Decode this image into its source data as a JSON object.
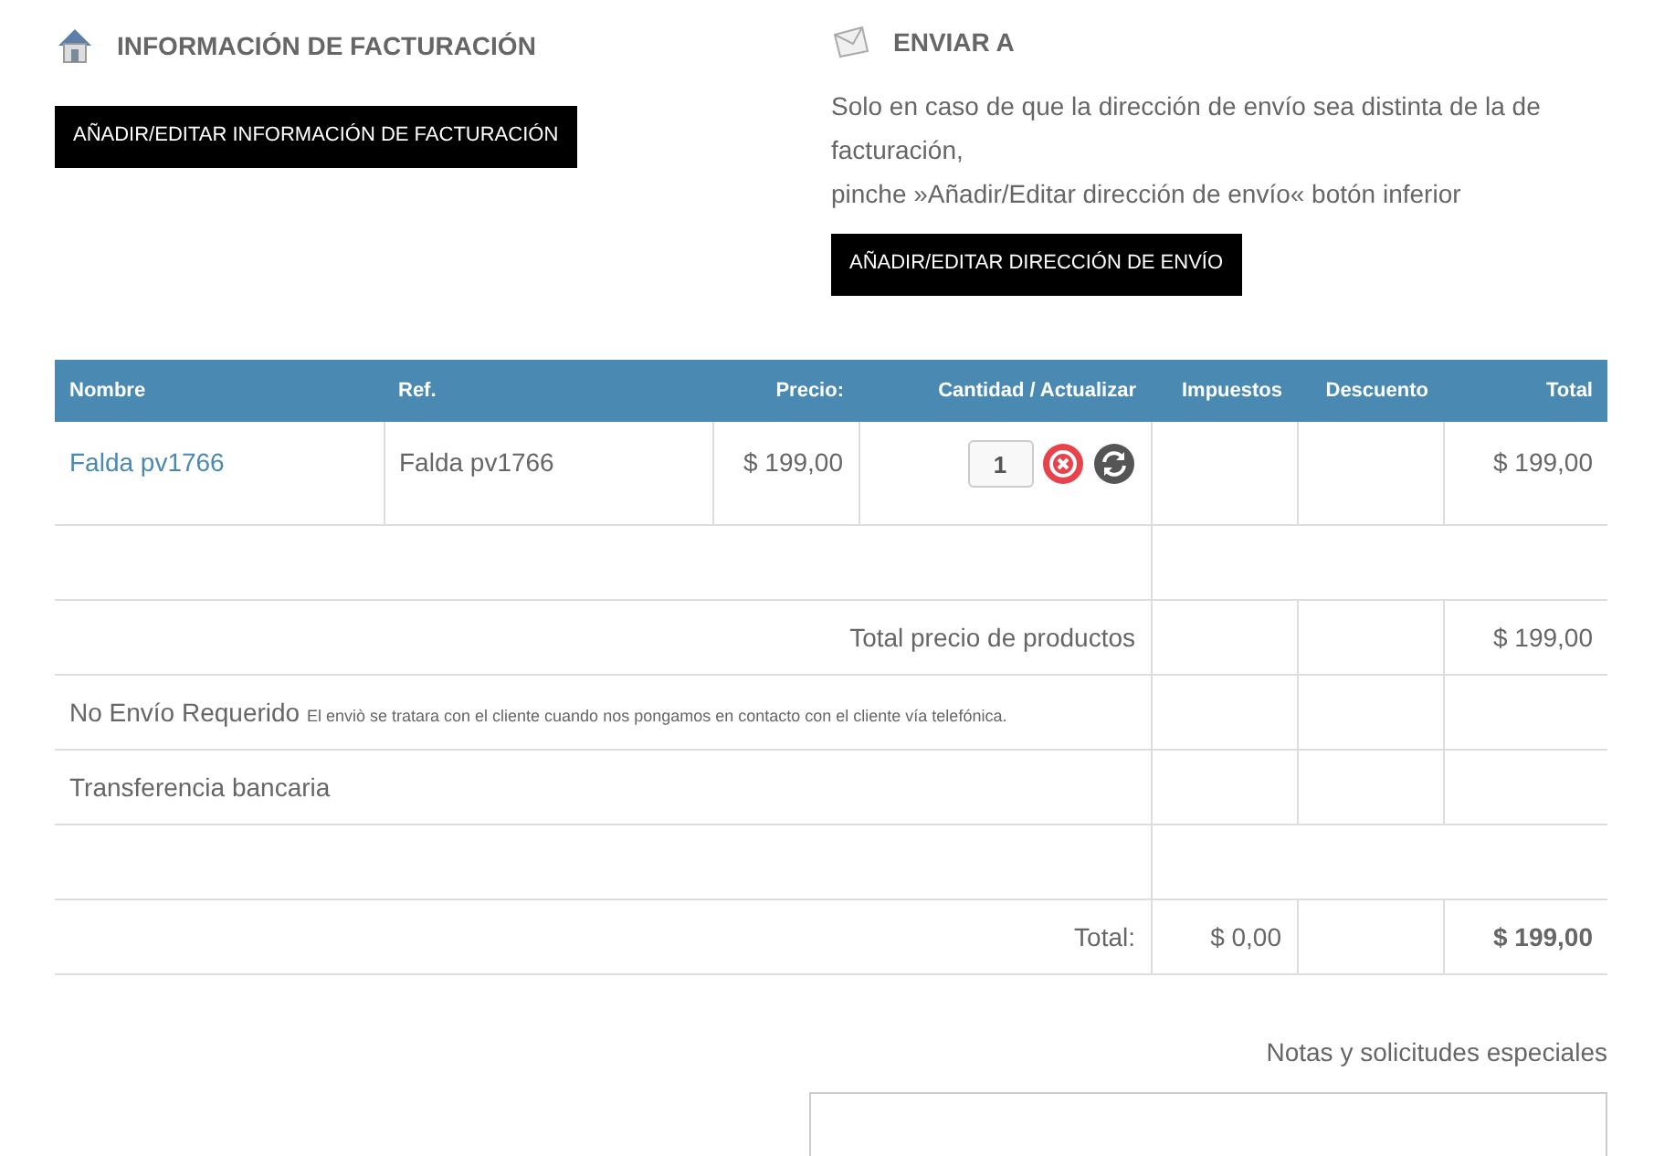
{
  "billing": {
    "title": "INFORMACIÓN DE FACTURACIÓN",
    "button": "AÑADIR/EDITAR INFORMACIÓN DE FACTURACIÓN"
  },
  "shipping": {
    "title": "ENVIAR A",
    "note_lines": [
      "Solo en caso de que la dirección de envío sea distinta de la de facturación,",
      "pinche »Añadir/Editar dirección de envío« botón inferior"
    ],
    "button": "AÑADIR/EDITAR DIRECCIÓN DE ENVÍO"
  },
  "cart": {
    "columns": [
      "Nombre",
      "Ref.",
      "Precio:",
      "Cantidad / Actualizar",
      "Impuestos",
      "Descuento",
      "Total"
    ],
    "rows": [
      {
        "kind": "product",
        "name": "Falda pv1766",
        "ref": "Falda pv1766",
        "price": "$ 199,00",
        "quantity": "1",
        "total": "$ 199,00"
      },
      {
        "kind": "spacer"
      },
      {
        "kind": "subtotal",
        "label": "Total precio de productos",
        "total": "$ 199,00"
      },
      {
        "kind": "shipping",
        "name": "No Envío Requerido",
        "note": "El enviò se tratara con el cliente cuando nos pongamos en contacto con el cliente vía telefónica."
      },
      {
        "kind": "payment",
        "name": "Transferencia bancaria"
      },
      {
        "kind": "spacer"
      },
      {
        "kind": "total",
        "label": "Total:",
        "tax": "$ 0,00",
        "total": "$ 199,00"
      }
    ]
  },
  "notes": {
    "label": "Notas y solicitudes especiales"
  }
}
